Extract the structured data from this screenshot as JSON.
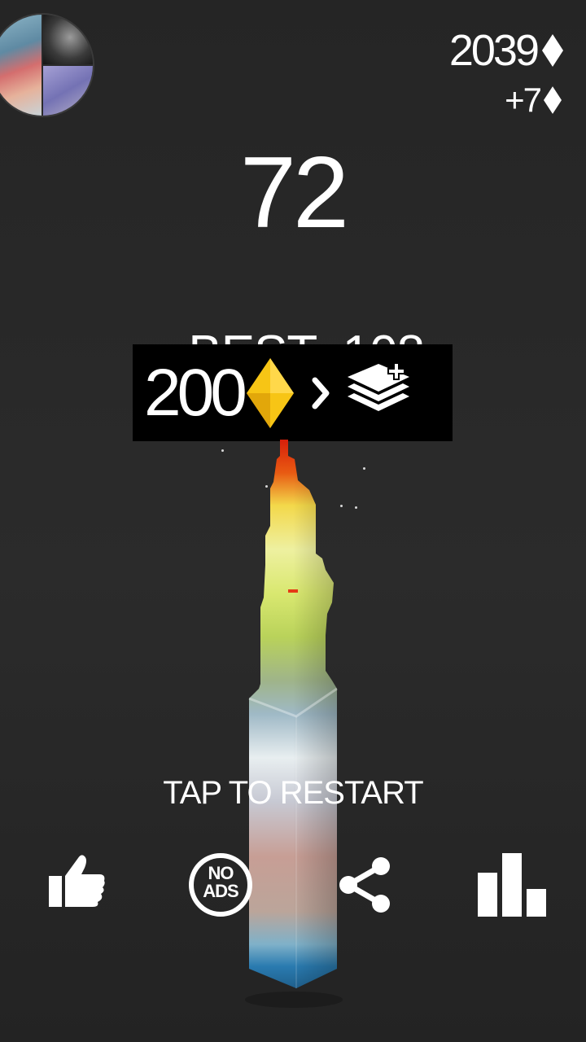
{
  "hud": {
    "gem_total": "2039",
    "gem_gain": "+7"
  },
  "score": {
    "current": "72",
    "best_label": "BEST",
    "best_value": "108",
    "best_text": "BEST  108"
  },
  "unlock": {
    "price": "200",
    "icon": "layers-plus-icon"
  },
  "restart_label": "TAP TO RESTART",
  "buttons": {
    "like": "thumbs-up-icon",
    "no_ads": {
      "line1": "NO",
      "line2": "ADS"
    },
    "share": "share-icon",
    "leaderboard": "leaderboard-icon"
  },
  "colors": {
    "background": "#272727",
    "text": "#ffffff",
    "gem_gold": "#f5c21b",
    "banner": "#000000"
  }
}
